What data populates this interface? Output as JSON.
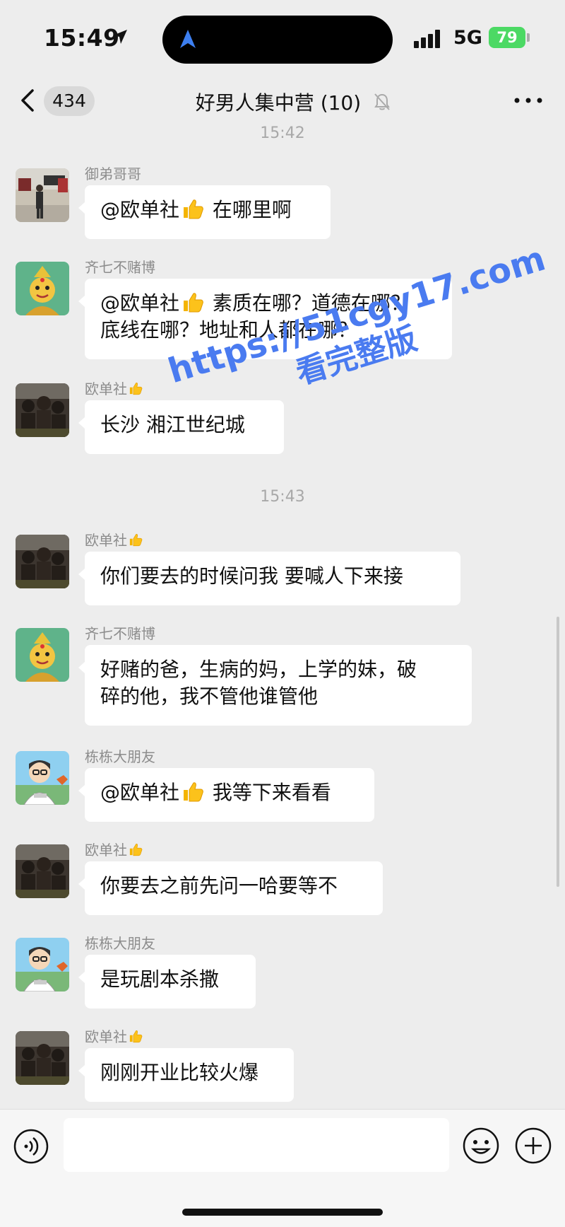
{
  "status_bar": {
    "time": "15:49",
    "network": "5G",
    "battery": "79"
  },
  "header": {
    "back_count": "434",
    "title": "好男人集中营 (10)"
  },
  "timestamps": [
    "15:42",
    "15:43"
  ],
  "messages": [
    {
      "sender": "御弟哥哥",
      "parts": [
        "@欧单社",
        "在哪里啊"
      ],
      "avatar": "avatar-city-photo"
    },
    {
      "sender": "齐七不赌博",
      "parts": [
        "@欧单社",
        "素质在哪？道德在哪？",
        "底线在哪？地址和人都在哪？"
      ],
      "avatar": "avatar-buddha-cartoon"
    },
    {
      "sender": "欧单社",
      "parts": [
        "长沙 湘江世纪城"
      ],
      "avatar": "avatar-dark-group-photo"
    },
    {
      "sender": "欧单社",
      "parts": [
        "你们要去的时候问我 要喊人下来接"
      ],
      "avatar": "avatar-dark-group-photo"
    },
    {
      "sender": "齐七不赌博",
      "parts": [
        "好赌的爸，生病的妈，上学的妹，破",
        "碎的他，我不管他谁管他"
      ],
      "avatar": "avatar-buddha-cartoon"
    },
    {
      "sender": "栋栋大朋友",
      "parts": [
        "@欧单社",
        "我等下来看看"
      ],
      "avatar": "avatar-cartoon-man"
    },
    {
      "sender": "欧单社",
      "parts": [
        "你要去之前先问一哈要等不"
      ],
      "avatar": "avatar-dark-group-photo"
    },
    {
      "sender": "栋栋大朋友",
      "parts": [
        "是玩剧本杀撒"
      ],
      "avatar": "avatar-cartoon-man"
    },
    {
      "sender": "欧单社",
      "parts": [
        "刚刚开业比较火爆"
      ],
      "avatar": "avatar-dark-group-photo"
    }
  ],
  "watermark": {
    "line1": "https://51cgy17.com",
    "line2": "看完整版"
  },
  "colors": {
    "background": "#ededed",
    "bubble": "#ffffff",
    "watermark": "#4a7bf0",
    "battery": "#4cd964"
  },
  "icons": [
    "location-arrow-icon",
    "signal-icon",
    "battery-icon",
    "back-chevron-icon",
    "mute-bell-icon",
    "more-icon",
    "thumbs-up-icon",
    "voice-icon",
    "emoji-icon",
    "plus-icon"
  ]
}
